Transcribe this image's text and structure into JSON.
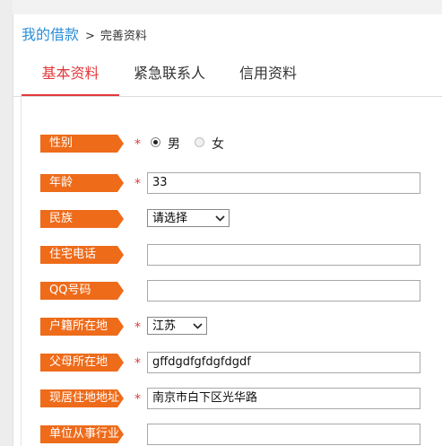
{
  "breadcrumb": {
    "link": "我的借款",
    "separator": ">",
    "current": "完善资料"
  },
  "tabs": [
    {
      "label": "基本资料",
      "active": true
    },
    {
      "label": "紧急联系人",
      "active": false
    },
    {
      "label": "信用资料",
      "active": false
    }
  ],
  "colors": {
    "accent": "#e4393c",
    "label_bg": "#ee6b1a",
    "link": "#2a8ed8"
  },
  "required_mark": "*",
  "form": {
    "gender": {
      "label": "性别",
      "required": true,
      "options": [
        "男",
        "女"
      ],
      "selected": "男"
    },
    "age": {
      "label": "年龄",
      "required": true,
      "value": "33"
    },
    "ethnicity": {
      "label": "民族",
      "required": false,
      "value": "请选择"
    },
    "home_phone": {
      "label": "住宅电话",
      "required": false,
      "value": ""
    },
    "qq": {
      "label": "QQ号码",
      "required": false,
      "value": ""
    },
    "hukou": {
      "label": "户籍所在地",
      "required": true,
      "value": "江苏"
    },
    "parents_location": {
      "label": "父母所在地",
      "required": true,
      "value": "gffdgdfgfdgfdgdf"
    },
    "current_address": {
      "label": "现居住地地址",
      "required": true,
      "value": "南京市白下区光华路"
    },
    "employer_industry": {
      "label": "单位从事行业",
      "required": false,
      "value": ""
    }
  }
}
